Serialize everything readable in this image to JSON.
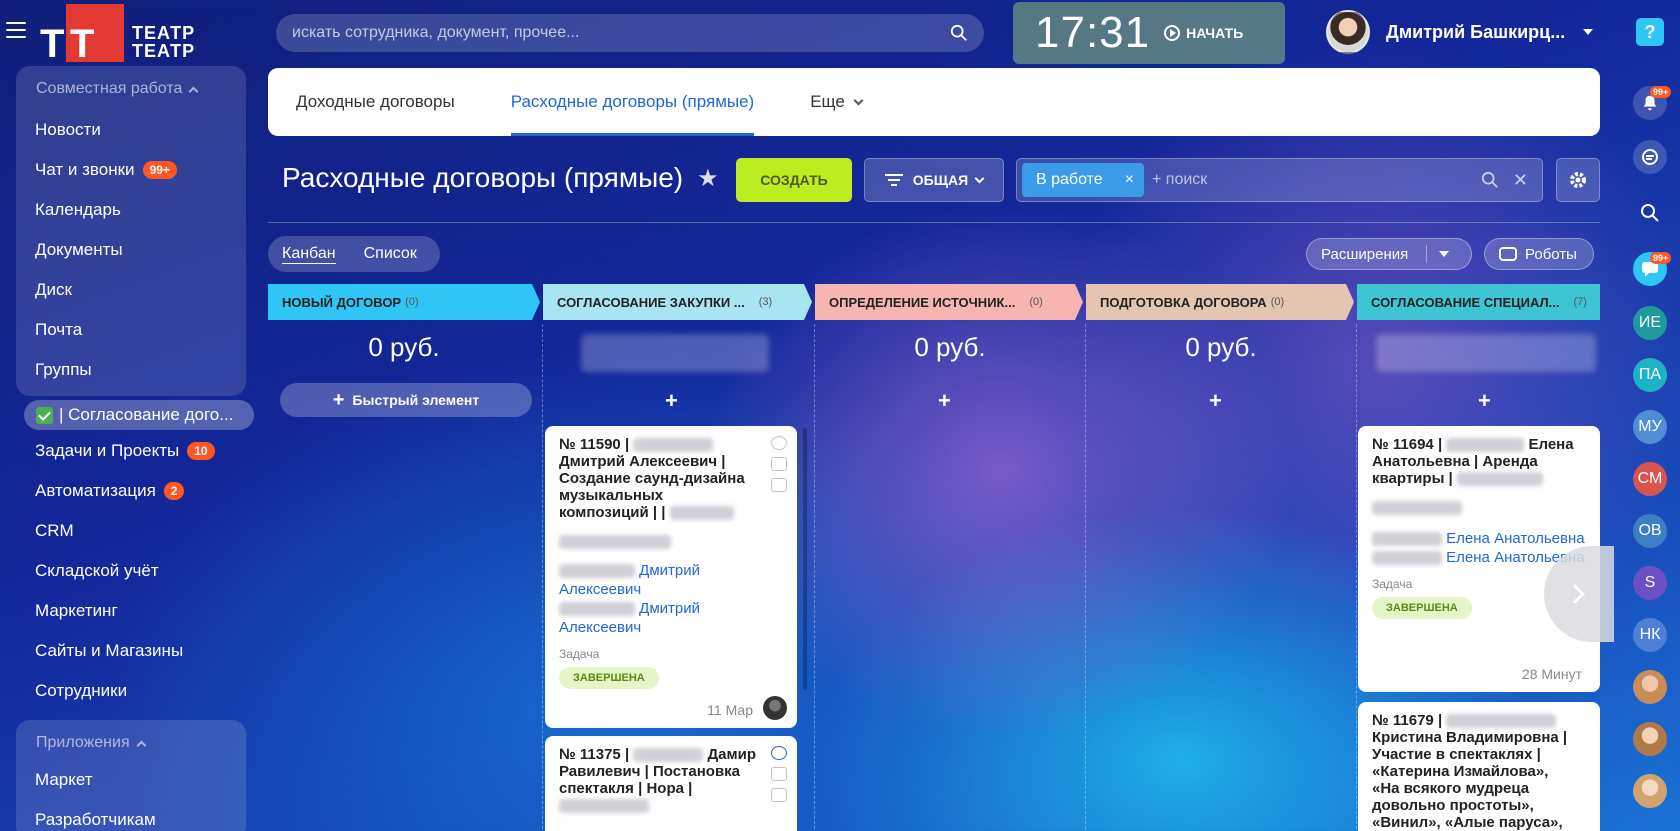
{
  "header": {
    "logo_text_line1": "ТЕАТР",
    "logo_text_line2": "ТЕАТР",
    "logo_mark": "ТТ",
    "search_placeholder": "искать сотрудника, документ, прочее...",
    "clock": "17:31",
    "start_label": "НАЧАТЬ",
    "user_name": "Дмитрий Башкирц..."
  },
  "sidebar": {
    "group1_title": "Совместная работа",
    "group1_items": [
      {
        "label": "Новости"
      },
      {
        "label": "Чат и звонки",
        "badge": "99+"
      },
      {
        "label": "Календарь"
      },
      {
        "label": "Документы"
      },
      {
        "label": "Диск"
      },
      {
        "label": "Почта"
      },
      {
        "label": "Группы"
      }
    ],
    "active_item": "| Согласование дого...",
    "items": [
      {
        "label": "Задачи и Проекты",
        "badge": "10"
      },
      {
        "label": "Автоматизация",
        "badge": "2"
      },
      {
        "label": "CRM"
      },
      {
        "label": "Складской учёт"
      },
      {
        "label": "Маркетинг"
      },
      {
        "label": "Сайты и Магазины"
      },
      {
        "label": "Сотрудники"
      }
    ],
    "group2_title": "Приложения",
    "group2_items": [
      {
        "label": "Маркет"
      },
      {
        "label": "Разработчикам"
      }
    ]
  },
  "tabs": [
    {
      "label": "Доходные договоры"
    },
    {
      "label": "Расходные договоры (прямые)"
    },
    {
      "label": "Еще"
    }
  ],
  "toolbar": {
    "page_title": "Расходные договоры (прямые)",
    "create_label": "СОЗДАТЬ",
    "filter_label": "ОБЩАЯ",
    "chip_label": "В работе",
    "chip_close": "×",
    "search_placeholder": "+ поиск",
    "clear": "✕"
  },
  "view": {
    "kanban": "Канбан",
    "list": "Список",
    "extensions": "Расширения",
    "robots": "Роботы"
  },
  "columns": [
    {
      "title": "НОВЫЙ ДОГОВОР",
      "count": "(0)",
      "sum": "0 руб.",
      "color": "#2fc6f6"
    },
    {
      "title": "СОГЛАСОВАНИЕ ЗАКУПКИ ...",
      "count": "(3)",
      "sum": "",
      "color": "#a8e4f2"
    },
    {
      "title": "ОПРЕДЕЛЕНИЕ ИСТОЧНИК...",
      "count": "(0)",
      "sum": "0 руб.",
      "color": "#f7b5b1"
    },
    {
      "title": "ПОДГОТОВКА ДОГОВОРА",
      "count": "(0)",
      "sum": "0 руб.",
      "color": "#e3c5b1"
    },
    {
      "title": "СОГЛАСОВАНИЕ СПЕЦИАЛ...",
      "count": "(7)",
      "sum": "",
      "color": "#3ec5d3"
    }
  ],
  "quick_add": "Быстрый элемент",
  "plus": "+",
  "cards": {
    "c1": {
      "number": "№ 11590 |",
      "title_rest": "Дмитрий Алексеевич | Создание саунд-дизайна музыкальных композиций | |",
      "contact1": "Дмитрий Алексеевич",
      "contact2": "Дмитрий Алексеевич",
      "task_label": "Задача",
      "status": "ЗАВЕРШЕНА",
      "date": "11 Мар"
    },
    "c2": {
      "number": "№ 11375 |",
      "title_tail": "Дамир",
      "title_rest": "Равилевич | Постановка спектакля | Нора |"
    },
    "c3": {
      "number": "№ 11694 |",
      "title_tail": "Елена",
      "title_rest": "Анатольевна | Аренда квартиры |",
      "contact1": "Елена Анатольевна",
      "contact2": "Елена Анатольевна",
      "task_label": "Задача",
      "status": "ЗАВЕРШЕНА",
      "date": "28 Минут"
    },
    "c4": {
      "number": "№ 11679 |",
      "title_rest": "Кристина Владимировна | Участие в спектаклях | «Катерина Измайлова», «На всякого мудреца довольно простоты», «Винил», «Алые паруса»,"
    }
  },
  "rail": {
    "help": "?",
    "notif_badge": "99+",
    "chat_badge": "99+",
    "avatars": [
      {
        "initials": "ИЕ",
        "color": "#1e9a9e"
      },
      {
        "initials": "ПА",
        "color": "#1eb2c9"
      },
      {
        "initials": "МУ",
        "color": "#4f8ed6"
      },
      {
        "initials": "СМ",
        "color": "#d9534f"
      },
      {
        "initials": "ОВ",
        "color": "#3d7fc4"
      },
      {
        "initials": "S",
        "color": "#6b4fc4"
      },
      {
        "initials": "НК",
        "color": "#4f7fd6"
      }
    ]
  }
}
